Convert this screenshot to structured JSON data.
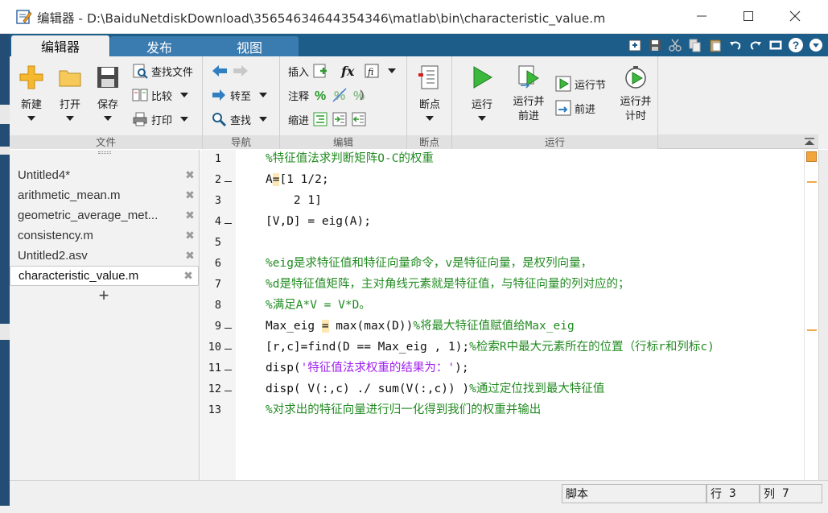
{
  "window": {
    "title": "编辑器 - D:\\BaiduNetdiskDownload\\35654634644354346\\matlab\\bin\\characteristic_value.m"
  },
  "ribbon_tabs": [
    "编辑器",
    "发布",
    "视图"
  ],
  "ribbon": {
    "file_group": {
      "label": "文件",
      "new": "新建",
      "open": "打开",
      "save": "保存",
      "find_files": "查找文件",
      "compare": "比较",
      "print": "打印"
    },
    "nav_group": {
      "label": "导航",
      "goto": "转至",
      "find": "查找"
    },
    "edit_group": {
      "label": "编辑",
      "insert": "插入",
      "comment": "注释",
      "indent": "缩进",
      "fx": "fx"
    },
    "breakpoint_group": {
      "label": "断点",
      "breakpoints": "断点"
    },
    "run_group": {
      "label": "运行",
      "run": "运行",
      "run_advance": "运行并\n前进",
      "run_section": "运行节",
      "advance": "前进",
      "run_time": "运行并\n计时"
    }
  },
  "files": [
    {
      "name": "Untitled4*",
      "active": false
    },
    {
      "name": "arithmetic_mean.m",
      "active": false
    },
    {
      "name": "geometric_average_met...",
      "active": false
    },
    {
      "name": "consistency.m",
      "active": false
    },
    {
      "name": "Untitled2.asv",
      "active": false
    },
    {
      "name": "characteristic_value.m",
      "active": true
    }
  ],
  "add_tab_label": "+",
  "code": {
    "line_numbers": [
      "1",
      "2",
      "3",
      "4",
      "5",
      "6",
      "7",
      "8",
      "9",
      "10",
      "11",
      "12",
      "13"
    ],
    "l1": "%特征值法求判断矩阵O-C的权重",
    "l2a": "A",
    "l2b": "=",
    "l2c": "[1 1/2;",
    "l3": "    2 1]",
    "l4": "[V,D] = eig(A);",
    "l5": "",
    "l6": "%eig是求特征值和特征向量命令，v是特征向量，是权列向量，",
    "l7": "%d是特征值矩阵，主对角线元素就是特征值，与特征向量的列对应的；",
    "l8": "%满足A*V = V*D。",
    "l9a": "Max_eig ",
    "l9b": "=",
    "l9c": " max(max(D))",
    "l9d": "%将最大特征值赋值给Max_eig",
    "l10a": "[r,c]=find(D == Max_eig , 1);",
    "l10b": "%检索R中最大元素所在的位置（行标r和列标c)",
    "l11a": "disp(",
    "l11b": "'特征值法求权重的结果为：'",
    "l11c": ");",
    "l12a": "disp( V(:,c) ./ sum(V(:,c)) )",
    "l12b": "%通过定位找到最大特征值",
    "l13": "%对求出的特征向量进行归一化得到我们的权重并输出"
  },
  "status": {
    "mode": "脚本",
    "row_label": "行",
    "row": "3",
    "col_label": "列",
    "col": "7"
  },
  "colors": {
    "tabbar": "#1c5d8a",
    "comment": "#228b22",
    "string": "#a020f0",
    "highlight": "#fde8b4"
  }
}
